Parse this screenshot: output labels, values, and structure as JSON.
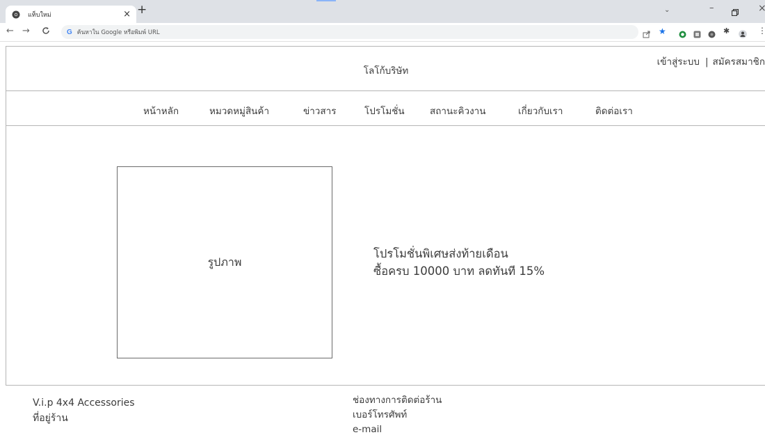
{
  "browser": {
    "tab_title": "แท็บใหม่",
    "tab_close": "×",
    "new_tab": "+",
    "omnibox_placeholder": "ค้นหาใน Google หรือพิมพ์ URL",
    "icons": [
      "back-icon",
      "forward-icon",
      "reload-icon",
      "google-icon",
      "share-icon",
      "bookmark-star-icon",
      "extension-green-icon",
      "extension-gray-icon",
      "extension-dark-icon",
      "puzzle-icon",
      "profile-icon",
      "menu-icon"
    ],
    "accent_color": "#1a73e8"
  },
  "header": {
    "logo_text": "โลโก้บริษัท",
    "login": "เข้าสู่ระบบ",
    "separator": "|",
    "register": "สมัครสมาชิก"
  },
  "nav": {
    "items": [
      "หน้าหลัก",
      "หมวดหมู่สินค้า",
      "ข่าวสาร",
      "โปรโมชั่น",
      "สถานะคิวงาน",
      "เกี่ยวกับเรา",
      "ติดต่อเรา"
    ]
  },
  "main": {
    "image_label": "รูปภาพ",
    "promo_line1": "โปรโมชั่นพิเศษส่งท้ายเดือน",
    "promo_line2": "ซื้อครบ 10000 บาท ลดทันที 15%"
  },
  "footer": {
    "shop_name": "V.i.p 4x4 Accessories",
    "address_label": "ที่อยู่ร้าน",
    "contact_title": "ช่องทางการติดต่อร้าน",
    "phone_label": "เบอร์โทรศัพท์",
    "email_label": "e-mail"
  }
}
